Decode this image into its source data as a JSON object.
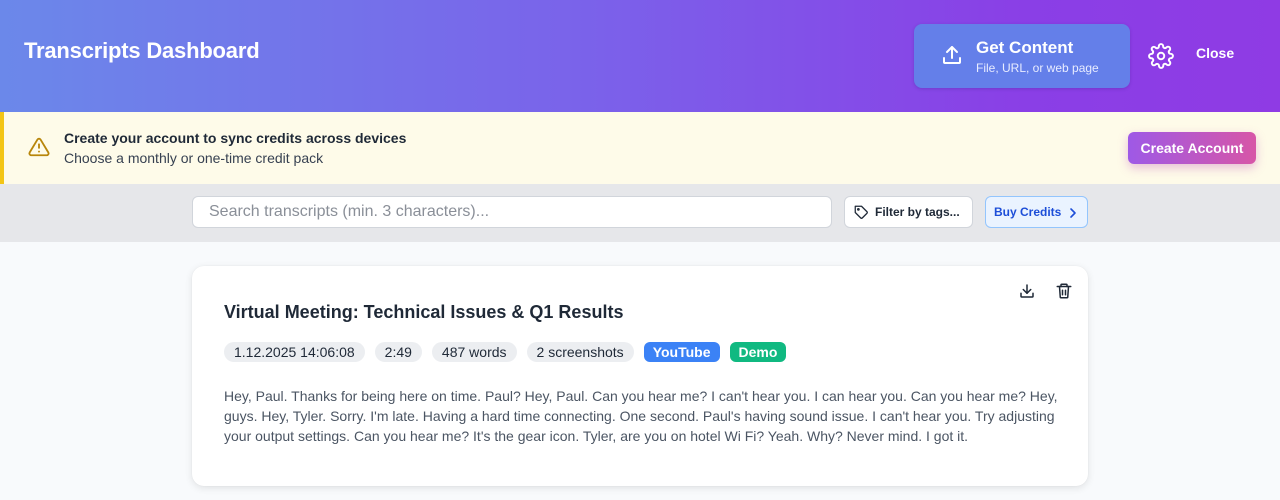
{
  "header": {
    "title": "Transcripts Dashboard",
    "get_content": {
      "label": "Get Content",
      "sublabel": "File, URL, or web page",
      "icon": "upload-icon"
    },
    "settings_icon": "gear-icon",
    "close_label": "Close"
  },
  "banner": {
    "icon": "warning-icon",
    "title": "Create your account to sync credits across devices",
    "subtitle": "Choose a monthly or one-time credit pack",
    "cta_label": "Create Account"
  },
  "toolbar": {
    "search_placeholder": "Search transcripts (min. 3 characters)...",
    "search_value": "",
    "filter_label": "Filter by tags...",
    "buy_label": "Buy Credits"
  },
  "transcripts": [
    {
      "title": "Virtual Meeting: Technical Issues & Q1 Results",
      "date": "1.12.2025 14:06:08",
      "duration": "2:49",
      "words": "487 words",
      "screenshots": "2 screenshots",
      "source_tag": "YouTube",
      "demo_tag": "Demo",
      "excerpt": "Hey, Paul. Thanks for being here on time. Paul? Hey, Paul. Can you hear me? I can't hear you. I can hear you. Can you hear me? Hey, guys. Hey, Tyler. Sorry. I'm late. Having a hard time connecting. One second. Paul's having sound issue. I can't hear you. Try adjusting your output settings. Can you hear me? It's the gear icon. Tyler, are you on hotel Wi Fi? Yeah. Why? Never mind. I got it."
    }
  ],
  "colors": {
    "header_gradient_start": "#6b88ea",
    "header_gradient_end": "#8f3be4",
    "banner_bg": "#fefbe9",
    "banner_accent": "#f3c515",
    "youtube_tag": "#3b82f6",
    "demo_tag": "#10b981"
  }
}
